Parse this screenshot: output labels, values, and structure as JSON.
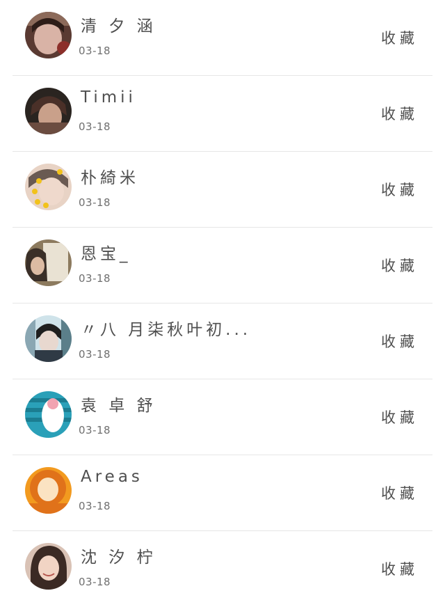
{
  "contacts": [
    {
      "name": "清 夕 涵",
      "date": "03-18",
      "action": "收藏",
      "avatar_icon": "girl-photo-avatar-icon",
      "avatar_colors": [
        "#5a3a32",
        "#d9b3a6",
        "#8c2f2a"
      ]
    },
    {
      "name": "Timii",
      "date": "03-18",
      "action": "收藏",
      "avatar_icon": "boy-photo-avatar-icon",
      "avatar_colors": [
        "#2a2420",
        "#6b4c40",
        "#c9a08a"
      ]
    },
    {
      "name": "朴綺米",
      "date": "03-18",
      "action": "收藏",
      "avatar_icon": "flower-crown-avatar-icon",
      "avatar_colors": [
        "#6a5a52",
        "#e8d3c5",
        "#f2c21b"
      ]
    },
    {
      "name": "恩宝_",
      "date": "03-18",
      "action": "收藏",
      "avatar_icon": "mirror-selfie-avatar-icon",
      "avatar_colors": [
        "#8c7a5e",
        "#e9e2d3",
        "#3a2f28"
      ]
    },
    {
      "name": "〃八 月柒秋叶初...",
      "date": "03-18",
      "action": "收藏",
      "avatar_icon": "anime-boy-avatar-icon",
      "avatar_colors": [
        "#2f3a45",
        "#cfe3ea",
        "#1f1f1f"
      ]
    },
    {
      "name": "袁 卓 舒",
      "date": "03-18",
      "action": "收藏",
      "avatar_icon": "stadium-avatar-icon",
      "avatar_colors": [
        "#2aa0b8",
        "#ffffff",
        "#f1a3b1"
      ]
    },
    {
      "name": "Areas",
      "date": "03-18",
      "action": "收藏",
      "avatar_icon": "orange-hood-avatar-icon",
      "avatar_colors": [
        "#f29a1f",
        "#fbe3c2",
        "#e0721a"
      ]
    },
    {
      "name": "沈 汐 柠",
      "date": "03-18",
      "action": "收藏",
      "avatar_icon": "smiling-girl-avatar-icon",
      "avatar_colors": [
        "#3b2a24",
        "#f1d4c4",
        "#d9c2b5"
      ]
    }
  ]
}
